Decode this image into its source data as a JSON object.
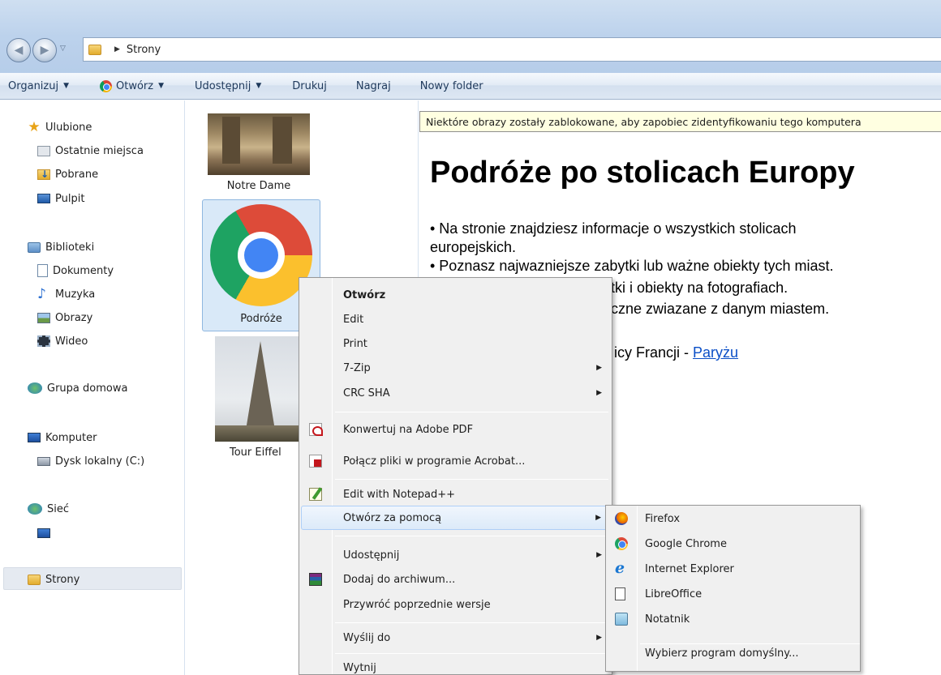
{
  "address": {
    "crumb": "Strony"
  },
  "toolbar": {
    "organize": "Organizuj",
    "open": "Otwórz",
    "share": "Udostępnij",
    "print": "Drukuj",
    "burn": "Nagraj",
    "new_folder": "Nowy folder"
  },
  "nav": {
    "favorites": "Ulubione",
    "recent": "Ostatnie miejsca",
    "downloads": "Pobrane",
    "desktop": "Pulpit",
    "libraries": "Biblioteki",
    "documents": "Dokumenty",
    "music": "Muzyka",
    "pictures": "Obrazy",
    "video": "Wideo",
    "homegroup": "Grupa domowa",
    "computer": "Komputer",
    "local_disk": "Dysk lokalny (C:)",
    "network": "Sieć",
    "selected_folder": "Strony"
  },
  "files": [
    {
      "name": "Notre Dame"
    },
    {
      "name": "Podróże"
    },
    {
      "name": "Tour Eiffel"
    }
  ],
  "preview": {
    "infobar": "Niektóre obrazy zostały zablokowane, aby zapobiec zidentyfikowaniu tego komputera",
    "title": "Podróże po stolicach Europy",
    "bullet1_a": "• Na stronie znajdziesz informacje o wszystkich stolicach",
    "bullet1_b": "europejskich.",
    "bullet2": "• Poznasz najwazniejsze zabytki lub ważne obiekty tych miast.",
    "bullet3_tail": "e zabytki i obiekty na fotografiach.",
    "bullet4_tail": "historyczne zwiazane z danym miastem.",
    "line5_tail": "icy Francji - ",
    "link": "Paryżu"
  },
  "context_menu": {
    "items": [
      {
        "label": "Otwórz",
        "bold": true
      },
      {
        "label": "Edit"
      },
      {
        "label": "Print"
      },
      {
        "label": "7-Zip"
      },
      {
        "label": "CRC SHA"
      },
      {
        "label": "Konwertuj na Adobe PDF"
      },
      {
        "label": "Połącz pliki w programie Acrobat..."
      },
      {
        "label": "Edit with Notepad++"
      },
      {
        "label": "Otwórz za pomocą"
      },
      {
        "label": "Udostępnij"
      },
      {
        "label": "Dodaj do archiwum..."
      },
      {
        "label": "Przywróć poprzednie wersje"
      },
      {
        "label": "Wyślij do"
      },
      {
        "label": "Wytnij"
      }
    ]
  },
  "submenu": {
    "items": [
      {
        "label": "Firefox"
      },
      {
        "label": "Google Chrome"
      },
      {
        "label": "Internet Explorer"
      },
      {
        "label": "LibreOffice"
      },
      {
        "label": "Notatnik"
      },
      {
        "label": "Wybierz program domyślny..."
      }
    ]
  }
}
